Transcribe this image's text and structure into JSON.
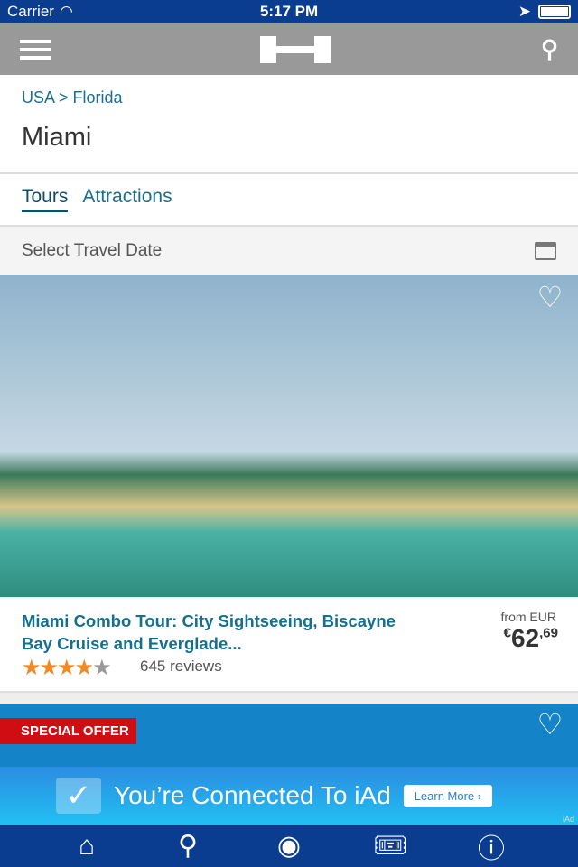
{
  "status": {
    "carrier": "Carrier",
    "time": "5:17 PM"
  },
  "breadcrumb": "USA > Florida",
  "title": "Miami",
  "tabs": [
    "Tours",
    "Attractions"
  ],
  "date_label": "Select Travel Date",
  "tour": {
    "title": "Miami Combo Tour: City Sightseeing, Biscayne Bay Cruise and Everglade...",
    "rating": 4,
    "rating_max": 5,
    "reviews": "645 reviews",
    "from": "from EUR",
    "currency": "€",
    "price_int": "62",
    "price_dec": ",69"
  },
  "offer": "SPECIAL OFFER",
  "iad": {
    "text": "You’re Connected To iAd",
    "button": "Learn More ›",
    "label": "iAd"
  },
  "bottom_tabs": [
    "home",
    "search",
    "location",
    "tickets",
    "info"
  ],
  "colors": {
    "nav": "#0a3d8f",
    "link": "#13708f",
    "offer": "#d00d12"
  }
}
